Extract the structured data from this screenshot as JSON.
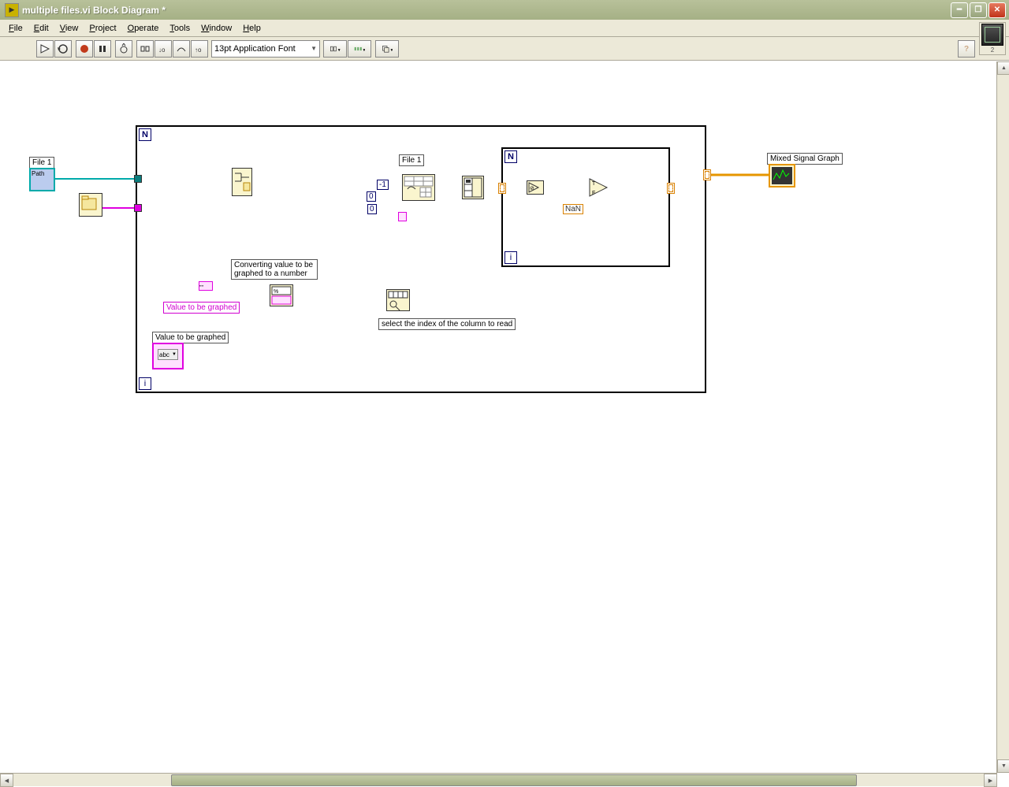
{
  "window": {
    "title": "multiple files.vi Block Diagram *"
  },
  "menu": {
    "file": "File",
    "edit": "Edit",
    "view": "View",
    "project": "Project",
    "operate": "Operate",
    "tools": "Tools",
    "window": "Window",
    "help": "Help"
  },
  "toolbar": {
    "font": "13pt Application Font"
  },
  "diagram": {
    "file1_a": "File 1",
    "file1_b": "File 1",
    "mixed_signal": "Mixed Signal Graph",
    "convert_comment": "Converting value to be graphed to a number",
    "value_graphed_label": "Value to be graphed",
    "value_graphed_ctrl": "Value to be graphed",
    "select_index": "select the index of the column to read",
    "nan": "NaN",
    "n": "N",
    "i": "i",
    "neg1": "-1",
    "zero1": "0",
    "zero2": "0",
    "path_text": "Path",
    "abc": "abc"
  }
}
